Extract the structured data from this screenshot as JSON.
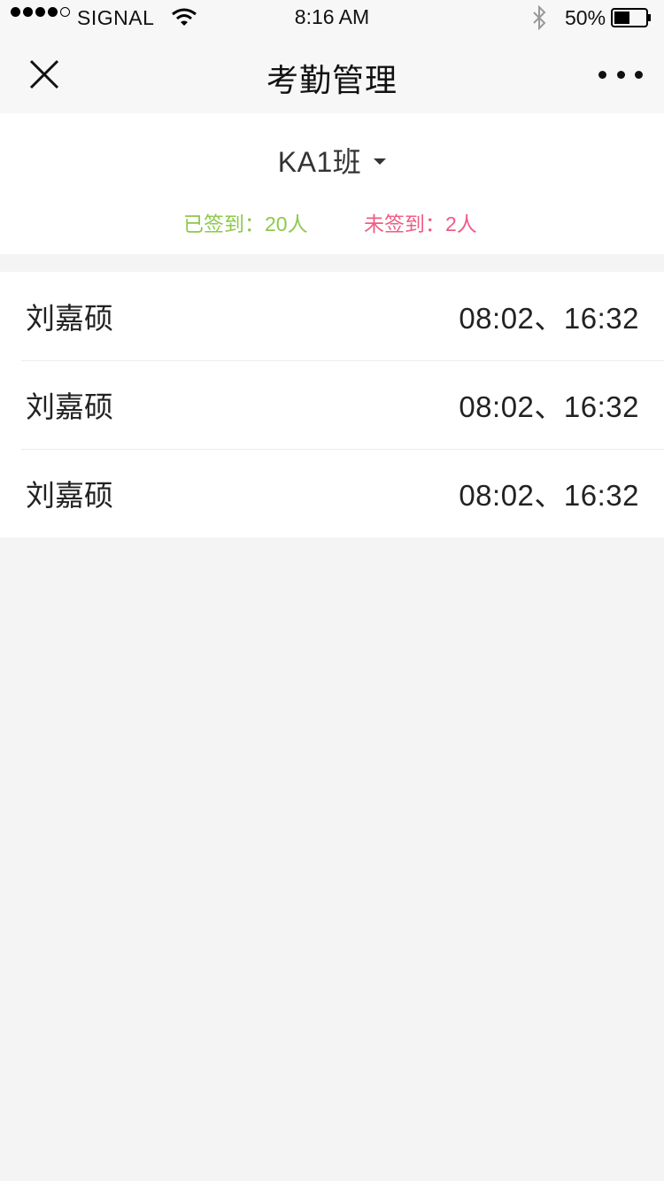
{
  "status_bar": {
    "carrier": "SIGNAL",
    "time": "8:16 AM",
    "battery": "50%",
    "battery_level": 0.5,
    "signal_bars": 4,
    "signal_total": 5
  },
  "nav": {
    "title": "考勤管理",
    "close_icon": "close-icon",
    "more_icon": "more-icon"
  },
  "class_selector": {
    "name": "KA1班",
    "caret_icon": "caret-down-icon"
  },
  "stats": {
    "signed": "已签到：20人",
    "unsigned": "未签到：2人",
    "signed_color": "#8ec94b",
    "unsigned_color": "#ef5c87"
  },
  "records": [
    {
      "name": "刘嘉硕",
      "times": "08:02、16:32"
    },
    {
      "name": "刘嘉硕",
      "times": "08:02、16:32"
    },
    {
      "name": "刘嘉硕",
      "times": "08:02、16:32"
    }
  ]
}
